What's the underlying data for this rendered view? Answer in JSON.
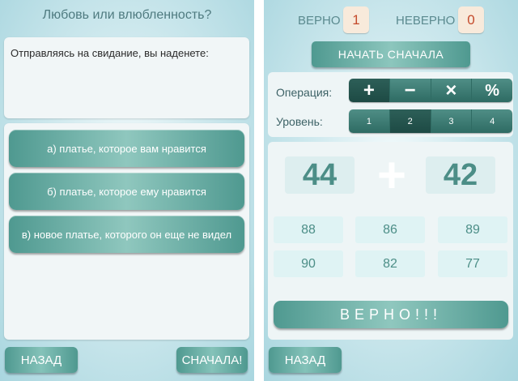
{
  "left_screen": {
    "title": "Любовь или влюбленность?",
    "question": "Отправляясь на свидание, вы наденете:",
    "answers": [
      {
        "label": "а) платье, которое вам нравится"
      },
      {
        "label": "б) платье, которое ему нравится"
      },
      {
        "label": "в) новое платье, которого он еще не видел"
      }
    ],
    "back_label": "НАЗАД",
    "restart_label": "СНАЧАЛА!"
  },
  "right_screen": {
    "score": {
      "correct_label": "ВЕРНО",
      "correct_value": "1",
      "wrong_label": "НЕВЕРНО",
      "wrong_value": "0"
    },
    "restart_label": "НАЧАТЬ СНАЧАЛА",
    "operation": {
      "label": "Операция:",
      "options": [
        {
          "icon": "plus-icon",
          "glyph": "+"
        },
        {
          "icon": "minus-icon",
          "glyph": "−"
        },
        {
          "icon": "multiply-icon",
          "glyph": "×"
        },
        {
          "icon": "divide-icon",
          "glyph": "%"
        }
      ],
      "selected_index": 0
    },
    "level": {
      "label": "Уровень:",
      "options": [
        "1",
        "2",
        "3",
        "4"
      ],
      "selected": "2"
    },
    "problem": {
      "operand_a": "44",
      "operator": "+",
      "operand_b": "42"
    },
    "choices": [
      "88",
      "86",
      "89",
      "90",
      "82",
      "77"
    ],
    "result": "ВЕРНО!!!",
    "back_label": "НАЗАД"
  },
  "colors": {
    "accent_teal": "#4f9990",
    "dark_teal": "#2e6b63",
    "score_text": "#c44a2b",
    "background": "#a9d6df"
  }
}
